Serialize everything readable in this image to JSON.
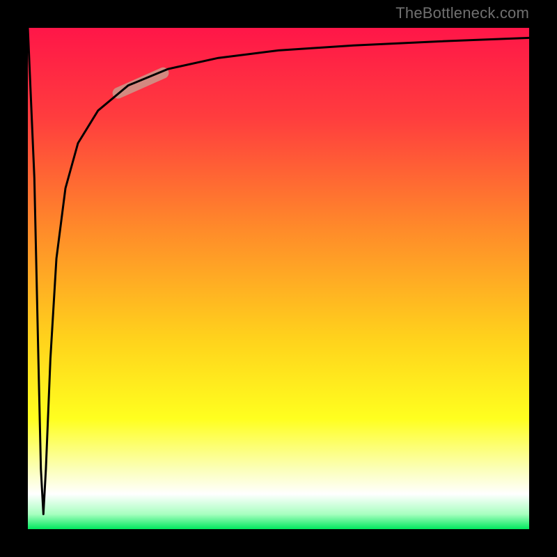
{
  "watermark": "TheBottleneck.com",
  "gradient": {
    "stops": [
      {
        "pct": 0,
        "color": "#ff1648"
      },
      {
        "pct": 18,
        "color": "#ff3d3e"
      },
      {
        "pct": 40,
        "color": "#ff8a2a"
      },
      {
        "pct": 62,
        "color": "#ffd21c"
      },
      {
        "pct": 78,
        "color": "#ffff1f"
      },
      {
        "pct": 88,
        "color": "#fbffb8"
      },
      {
        "pct": 93,
        "color": "#ffffff"
      },
      {
        "pct": 97,
        "color": "#a8ffc0"
      },
      {
        "pct": 100,
        "color": "#00e85e"
      }
    ]
  },
  "curve": {
    "color": "#000000",
    "width": 3,
    "points": [
      [
        0.0,
        1.0
      ],
      [
        0.013,
        0.7
      ],
      [
        0.021,
        0.34
      ],
      [
        0.026,
        0.12
      ],
      [
        0.031,
        0.03
      ],
      [
        0.036,
        0.12
      ],
      [
        0.045,
        0.34
      ],
      [
        0.057,
        0.54
      ],
      [
        0.075,
        0.68
      ],
      [
        0.1,
        0.77
      ],
      [
        0.14,
        0.835
      ],
      [
        0.2,
        0.885
      ],
      [
        0.28,
        0.918
      ],
      [
        0.38,
        0.94
      ],
      [
        0.5,
        0.955
      ],
      [
        0.65,
        0.965
      ],
      [
        0.82,
        0.973
      ],
      [
        1.0,
        0.98
      ]
    ]
  },
  "highlight": {
    "color": "#cf9185",
    "width": 16,
    "opacity": 0.92,
    "start": [
      0.18,
      0.87
    ],
    "end": [
      0.27,
      0.91
    ]
  },
  "chart_data": {
    "type": "line",
    "title": "",
    "xlabel": "",
    "ylabel": "",
    "xlim": [
      0,
      1
    ],
    "ylim": [
      0,
      1
    ],
    "series": [
      {
        "name": "curve",
        "x": [
          0.0,
          0.013,
          0.021,
          0.026,
          0.031,
          0.036,
          0.045,
          0.057,
          0.075,
          0.1,
          0.14,
          0.2,
          0.28,
          0.38,
          0.5,
          0.65,
          0.82,
          1.0
        ],
        "y": [
          1.0,
          0.7,
          0.34,
          0.12,
          0.03,
          0.12,
          0.34,
          0.54,
          0.68,
          0.77,
          0.835,
          0.885,
          0.918,
          0.94,
          0.955,
          0.965,
          0.973,
          0.98
        ]
      }
    ],
    "annotations": [
      {
        "kind": "segment-highlight",
        "x0": 0.18,
        "y0": 0.87,
        "x1": 0.27,
        "y1": 0.91
      }
    ],
    "watermark": "TheBottleneck.com"
  }
}
